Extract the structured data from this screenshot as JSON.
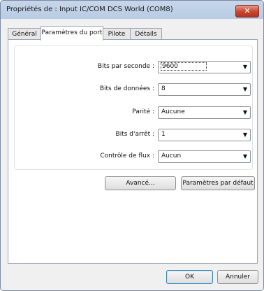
{
  "window": {
    "title": "Propriétés de : Input IC/COM DCS World (COM8)",
    "close_glyph": "✕"
  },
  "tabs": [
    {
      "label": "Général",
      "active": false
    },
    {
      "label": "Paramètres du port",
      "active": true
    },
    {
      "label": "Pilote",
      "active": false
    },
    {
      "label": "Détails",
      "active": false
    }
  ],
  "settings": {
    "bits_per_second": {
      "label": "Bits par seconde :",
      "value": "9600"
    },
    "data_bits": {
      "label": "Bits de données :",
      "value": "8"
    },
    "parity": {
      "label": "Parité :",
      "value": "Aucune"
    },
    "stop_bits": {
      "label": "Bits d'arrêt :",
      "value": "1"
    },
    "flow_control": {
      "label": "Contrôle de flux :",
      "value": "Aucun"
    }
  },
  "buttons": {
    "advanced": "Avancé...",
    "defaults": "Paramètres par défaut",
    "ok": "OK",
    "cancel": "Annuler"
  },
  "icons": {
    "dropdown": "chevron-down-icon",
    "close": "close-icon"
  }
}
